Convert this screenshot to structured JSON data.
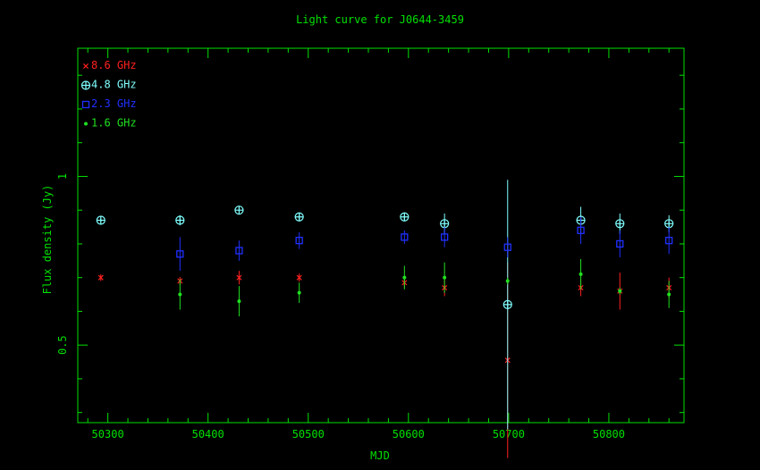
{
  "chart_data": {
    "type": "scatter",
    "title": "Light curve for J0644-3459",
    "xlabel": "MJD",
    "ylabel": "Flux density (Jy)",
    "xlim": [
      50270,
      50875
    ],
    "ylim": [
      0.27,
      1.38
    ],
    "xscale": "linear",
    "yscale": "linear",
    "grid": false,
    "legend_position": "top-left",
    "x_ticks": [
      50300,
      50400,
      50500,
      50600,
      50700,
      50800
    ],
    "y_ticks": [
      0.5,
      1
    ],
    "y_tick_labels": [
      "0.5",
      "1"
    ],
    "colors": {
      "axes": "#00e000",
      "background": "#000000"
    },
    "series": [
      {
        "name": "8.6 GHz",
        "marker": "x",
        "color": "#ff2020",
        "points": [
          {
            "x": 50293,
            "y": 0.7,
            "err": 0.01
          },
          {
            "x": 50372,
            "y": 0.69,
            "err": 0.012
          },
          {
            "x": 50431,
            "y": 0.7,
            "err": 0.02
          },
          {
            "x": 50491,
            "y": 0.7,
            "err": 0.012
          },
          {
            "x": 50596,
            "y": 0.685,
            "err": 0.015
          },
          {
            "x": 50636,
            "y": 0.67,
            "err": 0.025
          },
          {
            "x": 50699,
            "y": 0.455,
            "err": 0.29
          },
          {
            "x": 50772,
            "y": 0.67,
            "err": 0.025
          },
          {
            "x": 50811,
            "y": 0.66,
            "err": 0.055
          },
          {
            "x": 50860,
            "y": 0.67,
            "err": 0.03
          }
        ]
      },
      {
        "name": "4.8 GHz",
        "marker": "circle-plus",
        "color": "#80ffff",
        "points": [
          {
            "x": 50293,
            "y": 0.87,
            "err": 0.005
          },
          {
            "x": 50372,
            "y": 0.87,
            "err": 0.015
          },
          {
            "x": 50431,
            "y": 0.9,
            "err": 0.01
          },
          {
            "x": 50491,
            "y": 0.88,
            "err": 0.01
          },
          {
            "x": 50596,
            "y": 0.88,
            "err": 0.01
          },
          {
            "x": 50636,
            "y": 0.86,
            "err": 0.03
          },
          {
            "x": 50699,
            "y": 0.62,
            "err": 0.37
          },
          {
            "x": 50772,
            "y": 0.87,
            "err": 0.04
          },
          {
            "x": 50811,
            "y": 0.86,
            "err": 0.03
          },
          {
            "x": 50860,
            "y": 0.86,
            "err": 0.025
          }
        ]
      },
      {
        "name": "2.3 GHz",
        "marker": "square",
        "color": "#2030ff",
        "points": [
          {
            "x": 50372,
            "y": 0.77,
            "err": 0.05
          },
          {
            "x": 50431,
            "y": 0.78,
            "err": 0.03
          },
          {
            "x": 50491,
            "y": 0.81,
            "err": 0.025
          },
          {
            "x": 50596,
            "y": 0.82,
            "err": 0.02
          },
          {
            "x": 50636,
            "y": 0.82,
            "err": 0.03
          },
          {
            "x": 50699,
            "y": 0.79,
            "err": 0.03
          },
          {
            "x": 50772,
            "y": 0.84,
            "err": 0.04
          },
          {
            "x": 50811,
            "y": 0.8,
            "err": 0.04
          },
          {
            "x": 50860,
            "y": 0.81,
            "err": 0.04
          }
        ]
      },
      {
        "name": "1.6 GHz",
        "marker": "dot",
        "color": "#20e020",
        "points": [
          {
            "x": 50372,
            "y": 0.65,
            "err": 0.045
          },
          {
            "x": 50431,
            "y": 0.63,
            "err": 0.045
          },
          {
            "x": 50491,
            "y": 0.655,
            "err": 0.03
          },
          {
            "x": 50596,
            "y": 0.7,
            "err": 0.035
          },
          {
            "x": 50636,
            "y": 0.7,
            "err": 0.045
          },
          {
            "x": 50699,
            "y": 0.69,
            "err": 0.01
          },
          {
            "x": 50772,
            "y": 0.71,
            "err": 0.045
          },
          {
            "x": 50811,
            "y": 0.66,
            "err": 0.01
          },
          {
            "x": 50860,
            "y": 0.65,
            "err": 0.04
          }
        ]
      }
    ]
  }
}
